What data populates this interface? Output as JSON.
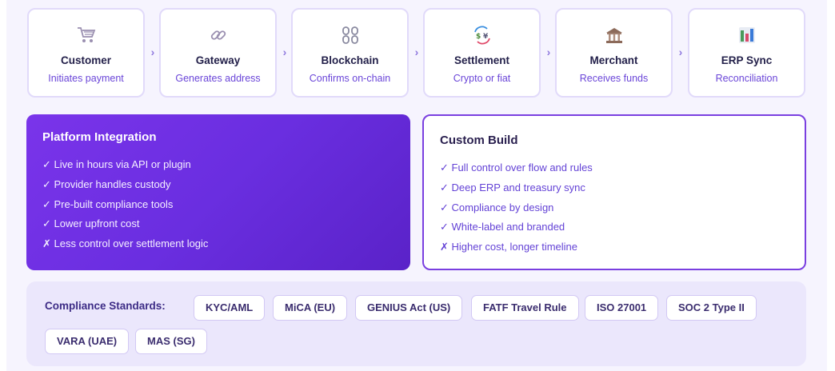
{
  "flow": {
    "steps": [
      {
        "title": "Customer",
        "subtitle": "Initiates payment",
        "icon": "shopping-cart-icon"
      },
      {
        "title": "Gateway",
        "subtitle": "Generates address",
        "icon": "link-icon"
      },
      {
        "title": "Blockchain",
        "subtitle": "Confirms on-chain",
        "icon": "chain-icon"
      },
      {
        "title": "Settlement",
        "subtitle": "Crypto or fiat",
        "icon": "currency-exchange-icon"
      },
      {
        "title": "Merchant",
        "subtitle": "Receives funds",
        "icon": "bank-icon"
      },
      {
        "title": "ERP Sync",
        "subtitle": "Reconciliation",
        "icon": "bar-chart-icon"
      }
    ],
    "separator": "›"
  },
  "platform": {
    "title": "Platform Integration",
    "items": [
      "✓ Live in hours via API or plugin",
      "✓ Provider handles custody",
      "✓ Pre-built compliance tools",
      "✓ Lower upfront cost",
      "✗ Less control over settlement logic"
    ]
  },
  "custom": {
    "title": "Custom Build",
    "items": [
      "✓ Full control over flow and rules",
      "✓ Deep ERP and treasury sync",
      "✓ Compliance by design",
      "✓ White-label and branded",
      "✗ Higher cost, longer timeline"
    ]
  },
  "compliance": {
    "label": "Compliance Standards:",
    "chips": [
      "KYC/AML",
      "MiCA (EU)",
      "GENIUS Act (US)",
      "FATF Travel Rule",
      "ISO 27001",
      "SOC 2 Type II",
      "VARA (UAE)",
      "MAS (SG)"
    ]
  },
  "colors": {
    "accent": "#7a34ea",
    "accent_dark": "#5a22c8",
    "subtitle": "#6a45d8",
    "panel_bg": "#ebe7fc",
    "page_bg": "#f6f4fe"
  }
}
